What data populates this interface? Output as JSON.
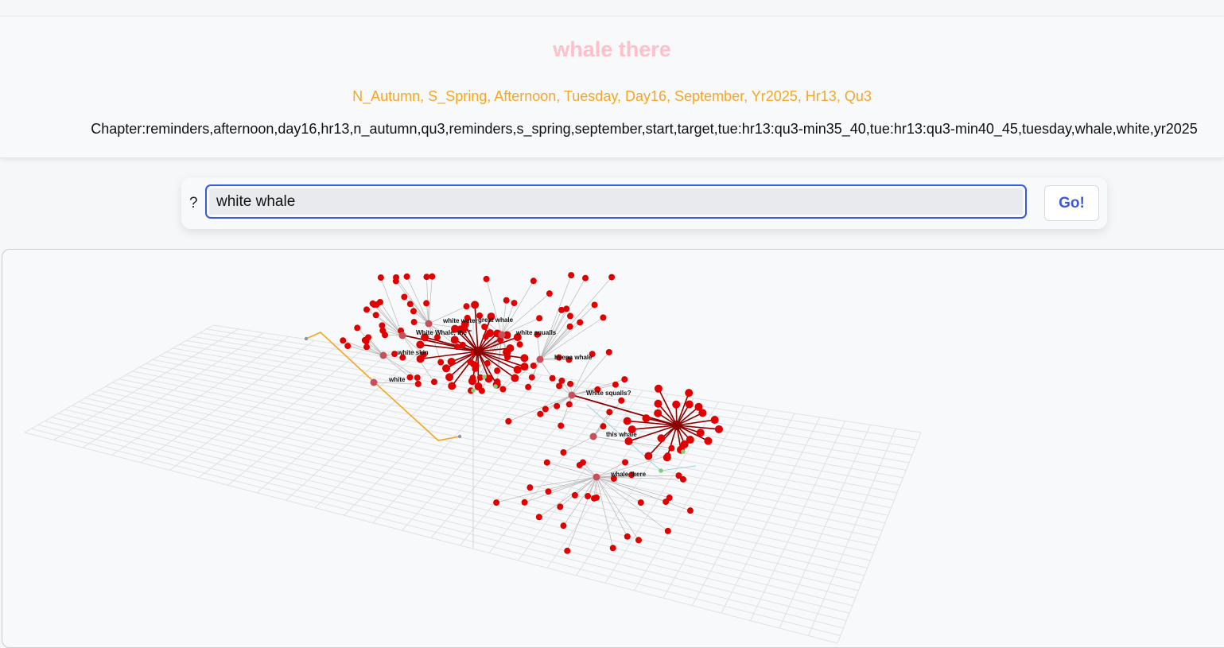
{
  "header": {
    "title": "whale there",
    "context": "N_Autumn, S_Spring, Afternoon, Tuesday, Day16, September, Yr2025, Hr13, Qu3",
    "chapter": "Chapter:reminders,afternoon,day16,hr13,n_autumn,qu3,reminders,s_spring,september,start,target,tue:hr13:qu3-min35_40,tue:hr13:qu3-min40_45,tuesday,whale,white,yr2025"
  },
  "search": {
    "prompt_label": "?",
    "value": "white whale",
    "go_label": "Go!"
  },
  "graph": {
    "labels": {
      "white_water": "white water",
      "great_whale": "great whale",
      "white_whale_the": "White Whale, the \"",
      "white_squalls": "white squalls",
      "white_skin": "white skin",
      "hyena_whale": "hyena whale",
      "white": "white",
      "white_squalls_q": "White squalls?",
      "this_whale": "this whale",
      "whale_there": "whale there"
    },
    "colors": {
      "node": "#e00000",
      "hub_edge": "#8b0000",
      "path": "#f5a623",
      "edge": "#b8b8b8",
      "teal_edge": "#9ed3e0",
      "green_node": "#7ed07e",
      "grid": "#dfe1e4"
    }
  }
}
